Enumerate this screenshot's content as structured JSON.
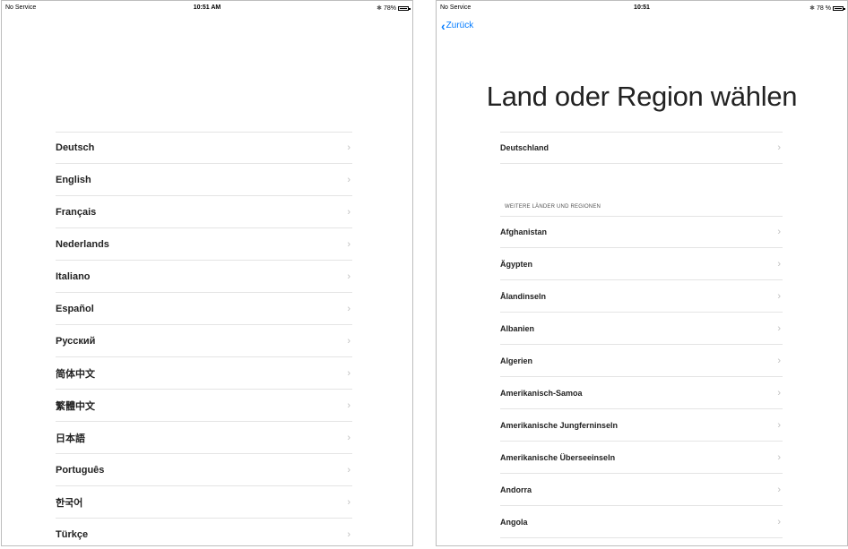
{
  "left": {
    "status": {
      "carrier": "No Service",
      "time": "10:51 AM",
      "battery": "78%"
    },
    "languages": [
      "Deutsch",
      "English",
      "Français",
      "Nederlands",
      "Italiano",
      "Español",
      "Русский",
      "简体中文",
      "繁體中文",
      "日本語",
      "Português",
      "한국어",
      "Türkçe"
    ]
  },
  "right": {
    "status": {
      "carrier": "No Service",
      "time": "10:51",
      "battery": "78 %"
    },
    "back_label": "Zurück",
    "title": "Land oder Region wählen",
    "top_region": "Deutschland",
    "section_header": "WEITERE LÄNDER UND REGIONEN",
    "regions": [
      "Afghanistan",
      "Ägypten",
      "Ålandinseln",
      "Albanien",
      "Algerien",
      "Amerikanisch-Samoa",
      "Amerikanische Jungferninseln",
      "Amerikanische Überseeinseln",
      "Andorra",
      "Angola"
    ]
  },
  "icons": {
    "chevron": "›",
    "back": "‹",
    "bluetooth": "✱"
  }
}
